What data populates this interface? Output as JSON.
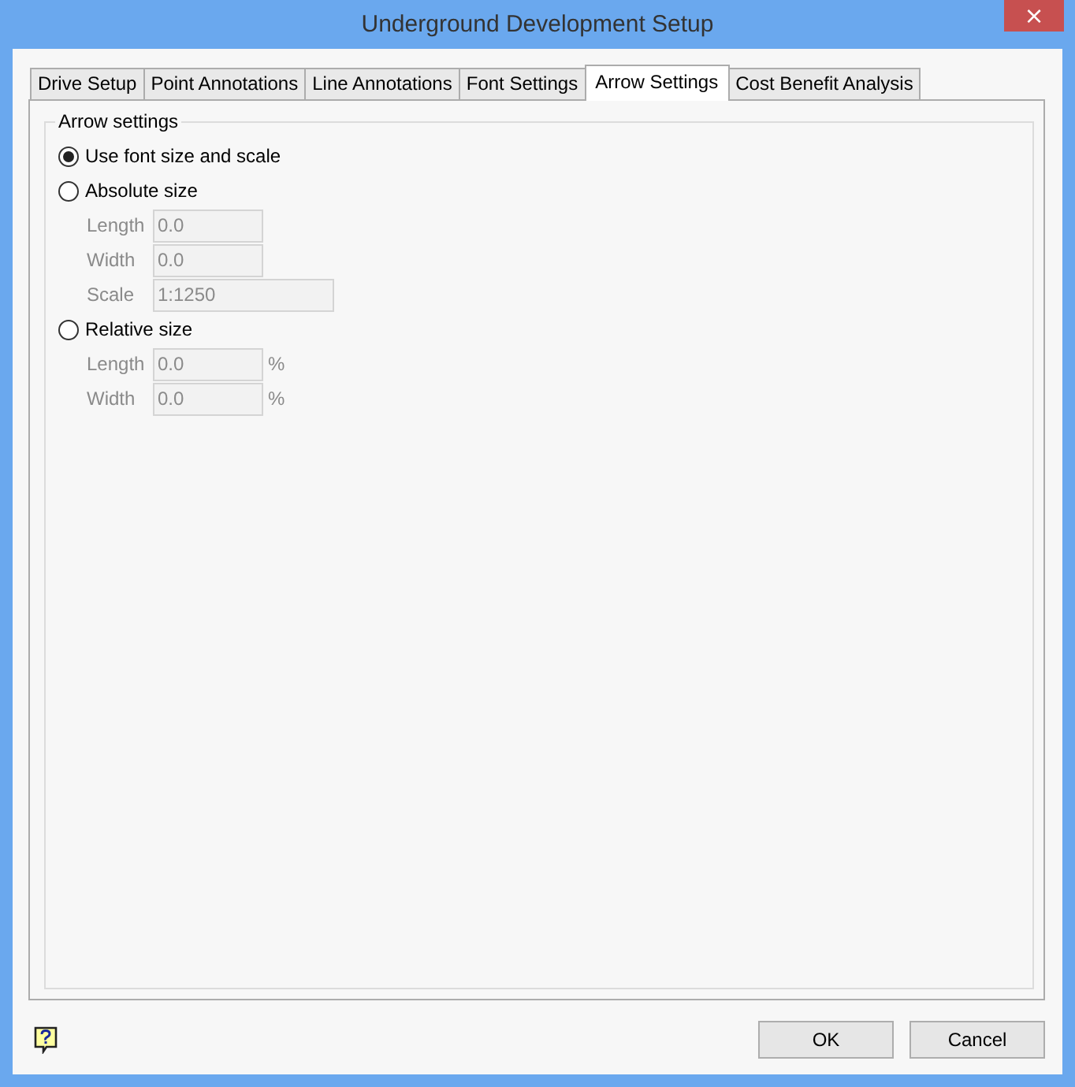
{
  "window": {
    "title": "Underground Development Setup",
    "close": "×"
  },
  "tabs": [
    {
      "label": "Drive Setup",
      "selected": false
    },
    {
      "label": "Point Annotations",
      "selected": false
    },
    {
      "label": "Line Annotations",
      "selected": false
    },
    {
      "label": "Font Settings",
      "selected": false
    },
    {
      "label": "Arrow Settings",
      "selected": true
    },
    {
      "label": "Cost Benefit Analysis",
      "selected": false
    }
  ],
  "group": {
    "title": "Arrow settings",
    "options": [
      {
        "label": "Use font size and scale",
        "selected": true
      },
      {
        "label": "Absolute size",
        "selected": false,
        "fields": [
          {
            "label": "Length",
            "value": "0.0",
            "disabled": true
          },
          {
            "label": "Width",
            "value": "0.0",
            "disabled": true
          },
          {
            "label": "Scale",
            "value": "1:1250",
            "disabled": true
          }
        ]
      },
      {
        "label": "Relative size",
        "selected": false,
        "fields": [
          {
            "label": "Length",
            "value": "0.0",
            "disabled": true,
            "unit": "%"
          },
          {
            "label": "Width",
            "value": "0.0",
            "disabled": true,
            "unit": "%"
          }
        ]
      }
    ]
  },
  "buttons": [
    "OK",
    "Cancel"
  ]
}
